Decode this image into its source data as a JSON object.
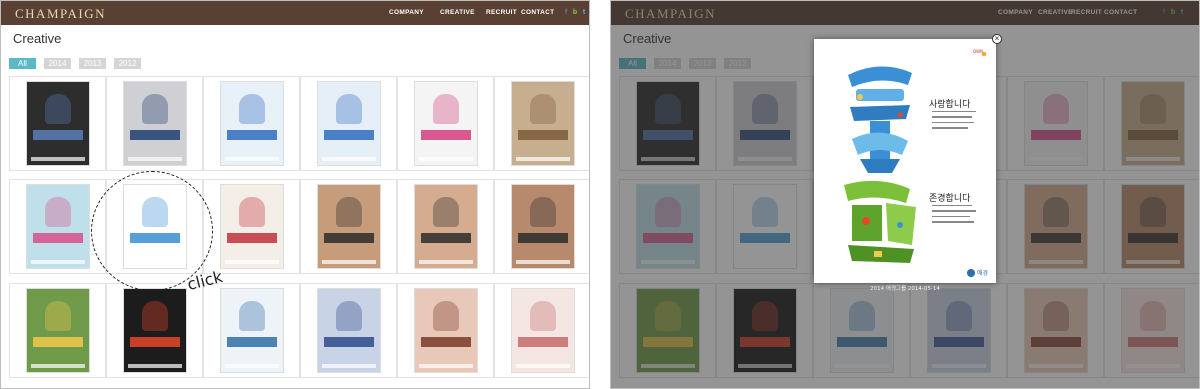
{
  "header": {
    "logo": "CHAMPAIGN",
    "nav": [
      "COMPANY",
      "CREATIVE",
      "RECRUIT",
      "CONTACT"
    ],
    "social_icons": [
      {
        "name": "facebook-icon",
        "glyph": "f",
        "color": "#3b5998"
      },
      {
        "name": "blog-icon",
        "glyph": "b",
        "color": "#59b237"
      },
      {
        "name": "twitter-icon",
        "glyph": "t",
        "color": "#29a9e0"
      }
    ]
  },
  "page": {
    "title": "Creative",
    "filters": [
      "All",
      "2014",
      "2013",
      "2012"
    ],
    "active_filter": "All"
  },
  "gallery": {
    "items": [
      {
        "name": "ad-product-lineup",
        "bg": "#2d2d2d",
        "accent": "#5a7fb8"
      },
      {
        "name": "ad-woman-sitting",
        "bg": "#cfcfd4",
        "accent": "#1d3d6e"
      },
      {
        "name": "ad-recruit-poster-1",
        "bg": "#e8f0f8",
        "accent": "#2d6cc0"
      },
      {
        "name": "ad-recruit-poster-2",
        "bg": "#e6eef7",
        "accent": "#2d6cc0"
      },
      {
        "name": "ad-hello-group",
        "bg": "#f4f4f4",
        "accent": "#d23d7c"
      },
      {
        "name": "ad-student-backpack",
        "bg": "#c7ae8f",
        "accent": "#7a5a3a"
      },
      {
        "name": "ad-scooter-couple",
        "bg": "#bfe0ea",
        "accent": "#d84d8a"
      },
      {
        "name": "ad-love-respect",
        "bg": "#ffffff",
        "accent": "#3a8ed1"
      },
      {
        "name": "ad-infographic",
        "bg": "#f3eee8",
        "accent": "#c0303a"
      },
      {
        "name": "ad-feel-good-man",
        "bg": "#c69c7a",
        "accent": "#2c2c2c"
      },
      {
        "name": "ad-feel-good-woman",
        "bg": "#d6ac90",
        "accent": "#2c2c2c"
      },
      {
        "name": "ad-feel-good-smile",
        "bg": "#b78a6d",
        "accent": "#2c2c2c"
      },
      {
        "name": "ad-forest-walk",
        "bg": "#6f9a4a",
        "accent": "#f2c94c"
      },
      {
        "name": "ad-runner-dark",
        "bg": "#1c1c1c",
        "accent": "#e8462b"
      },
      {
        "name": "ad-building-book",
        "bg": "#eef3f7",
        "accent": "#2f6ea8"
      },
      {
        "name": "ad-beauty-face",
        "bg": "#c9d3e6",
        "accent": "#2f4a8a"
      },
      {
        "name": "ad-bob-hair-face",
        "bg": "#e8c8b8",
        "accent": "#7a3a2a"
      },
      {
        "name": "ad-cosmetic-bottle",
        "bg": "#f4e6e2",
        "accent": "#c46b6b"
      }
    ]
  },
  "modal": {
    "brand": "애경",
    "heading_love": "사랑합니다",
    "heading_respect": "존경합니다",
    "caption": "2014 애경그룹 2014-05-14",
    "close_label": "×"
  },
  "annotation": {
    "click_label": "click"
  }
}
